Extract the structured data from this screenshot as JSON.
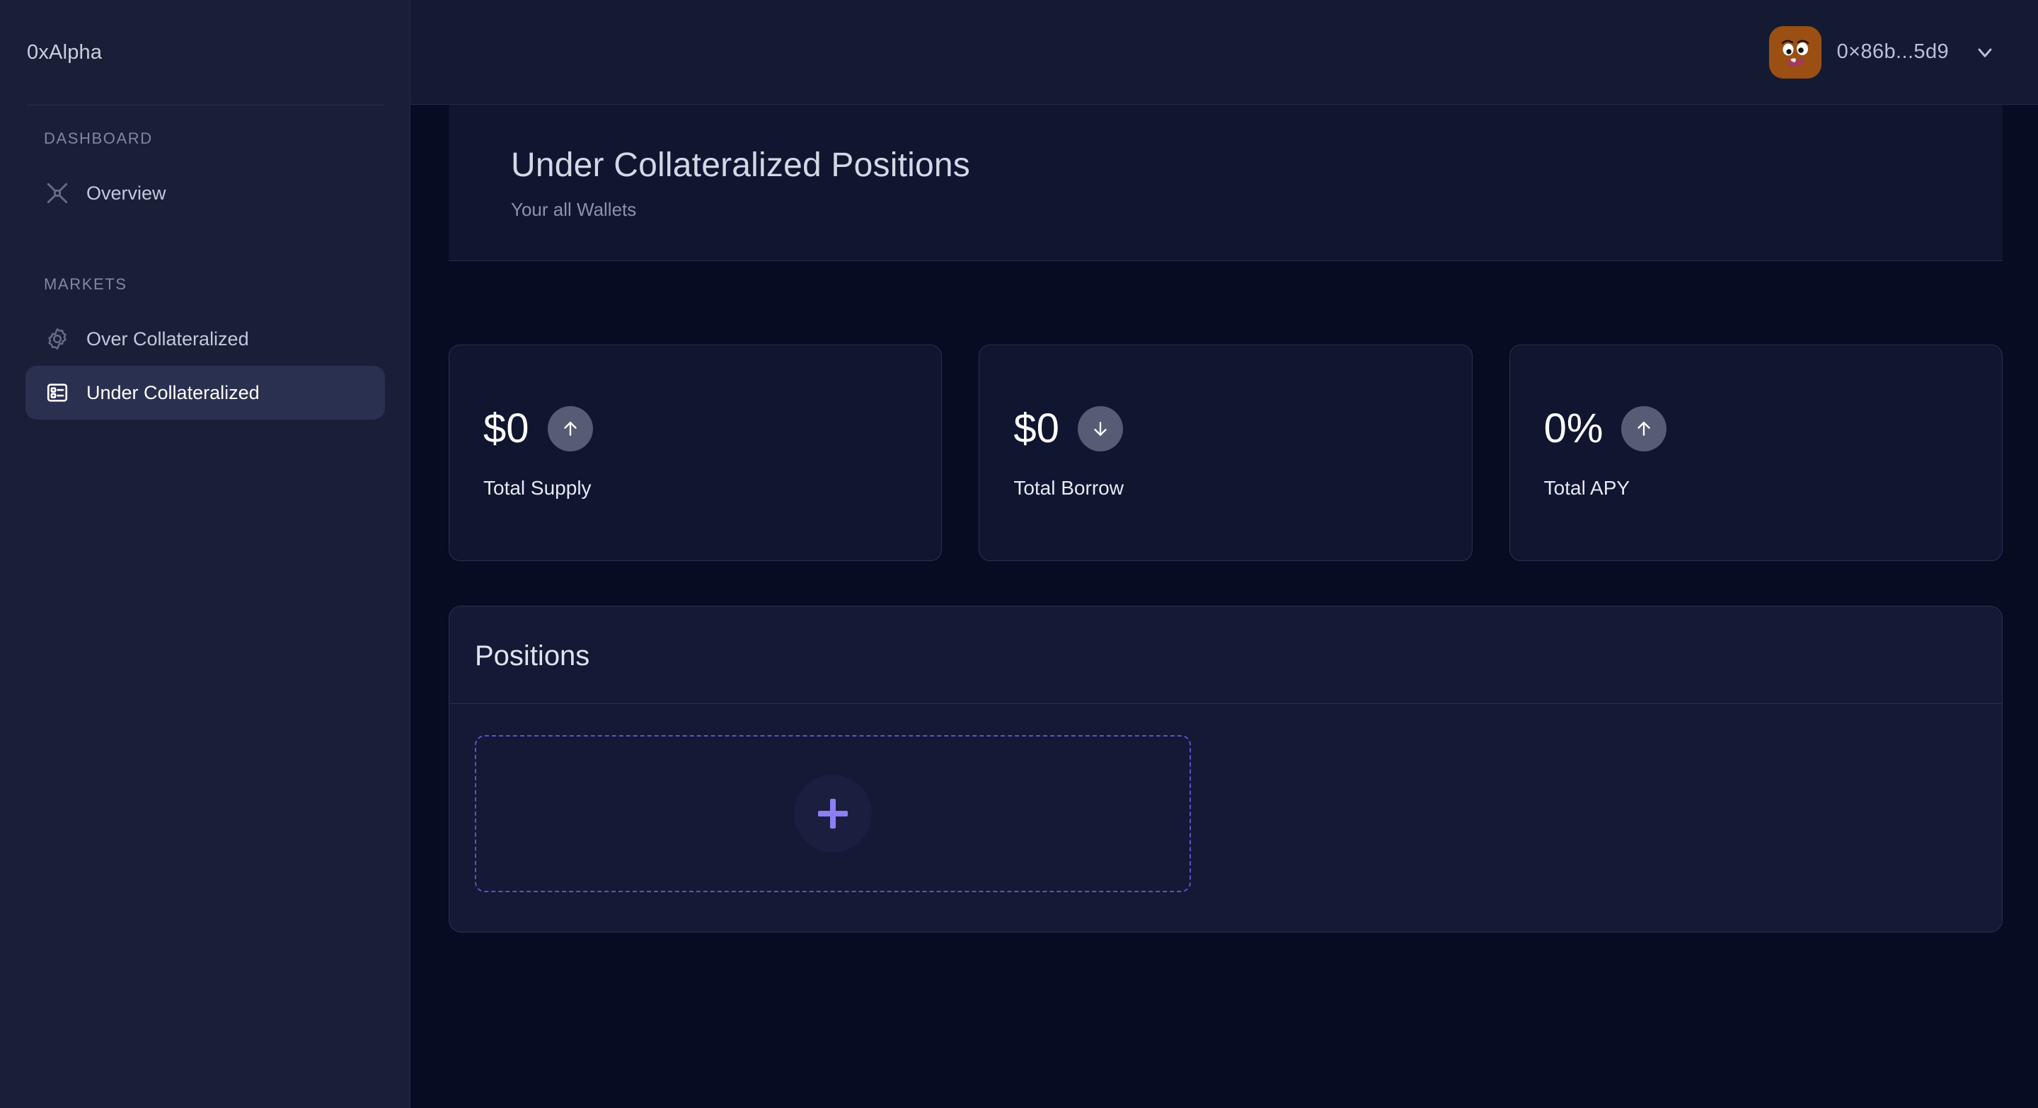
{
  "app": {
    "brand": "0xAlpha",
    "accent_purple": "#8d7ff2",
    "sidebar_bg": "#1a1f38",
    "main_bg": "#070c23",
    "card_bg": "#101530",
    "active_item_bg": "#2a3050"
  },
  "sidebar": {
    "sections": [
      {
        "heading": "DASHBOARD",
        "items": [
          {
            "label": "Overview",
            "icon": "crossed-tools-icon",
            "active": false
          }
        ]
      },
      {
        "heading": "MARKETS",
        "items": [
          {
            "label": "Over Collateralized",
            "icon": "gear-icon",
            "active": false
          },
          {
            "label": "Under Collateralized",
            "icon": "list-card-icon",
            "active": true
          }
        ]
      }
    ]
  },
  "topbar": {
    "wallet_address": "0×86b...5d9",
    "avatar_icon": "avatar-emoji-face",
    "chevron_icon": "chevron-down-icon"
  },
  "hero": {
    "title": "Under Collateralized Positions",
    "subtitle": "Your all Wallets"
  },
  "stats": [
    {
      "value": "$0",
      "label": "Total Supply",
      "trend": "up",
      "badge_icon": "arrow-up-icon"
    },
    {
      "value": "$0",
      "label": "Total Borrow",
      "trend": "down",
      "badge_icon": "arrow-down-icon"
    },
    {
      "value": "0%",
      "label": "Total APY",
      "trend": "up",
      "badge_icon": "arrow-up-icon"
    }
  ],
  "positions": {
    "title": "Positions",
    "add_slot_icon": "plus-icon",
    "items": []
  }
}
